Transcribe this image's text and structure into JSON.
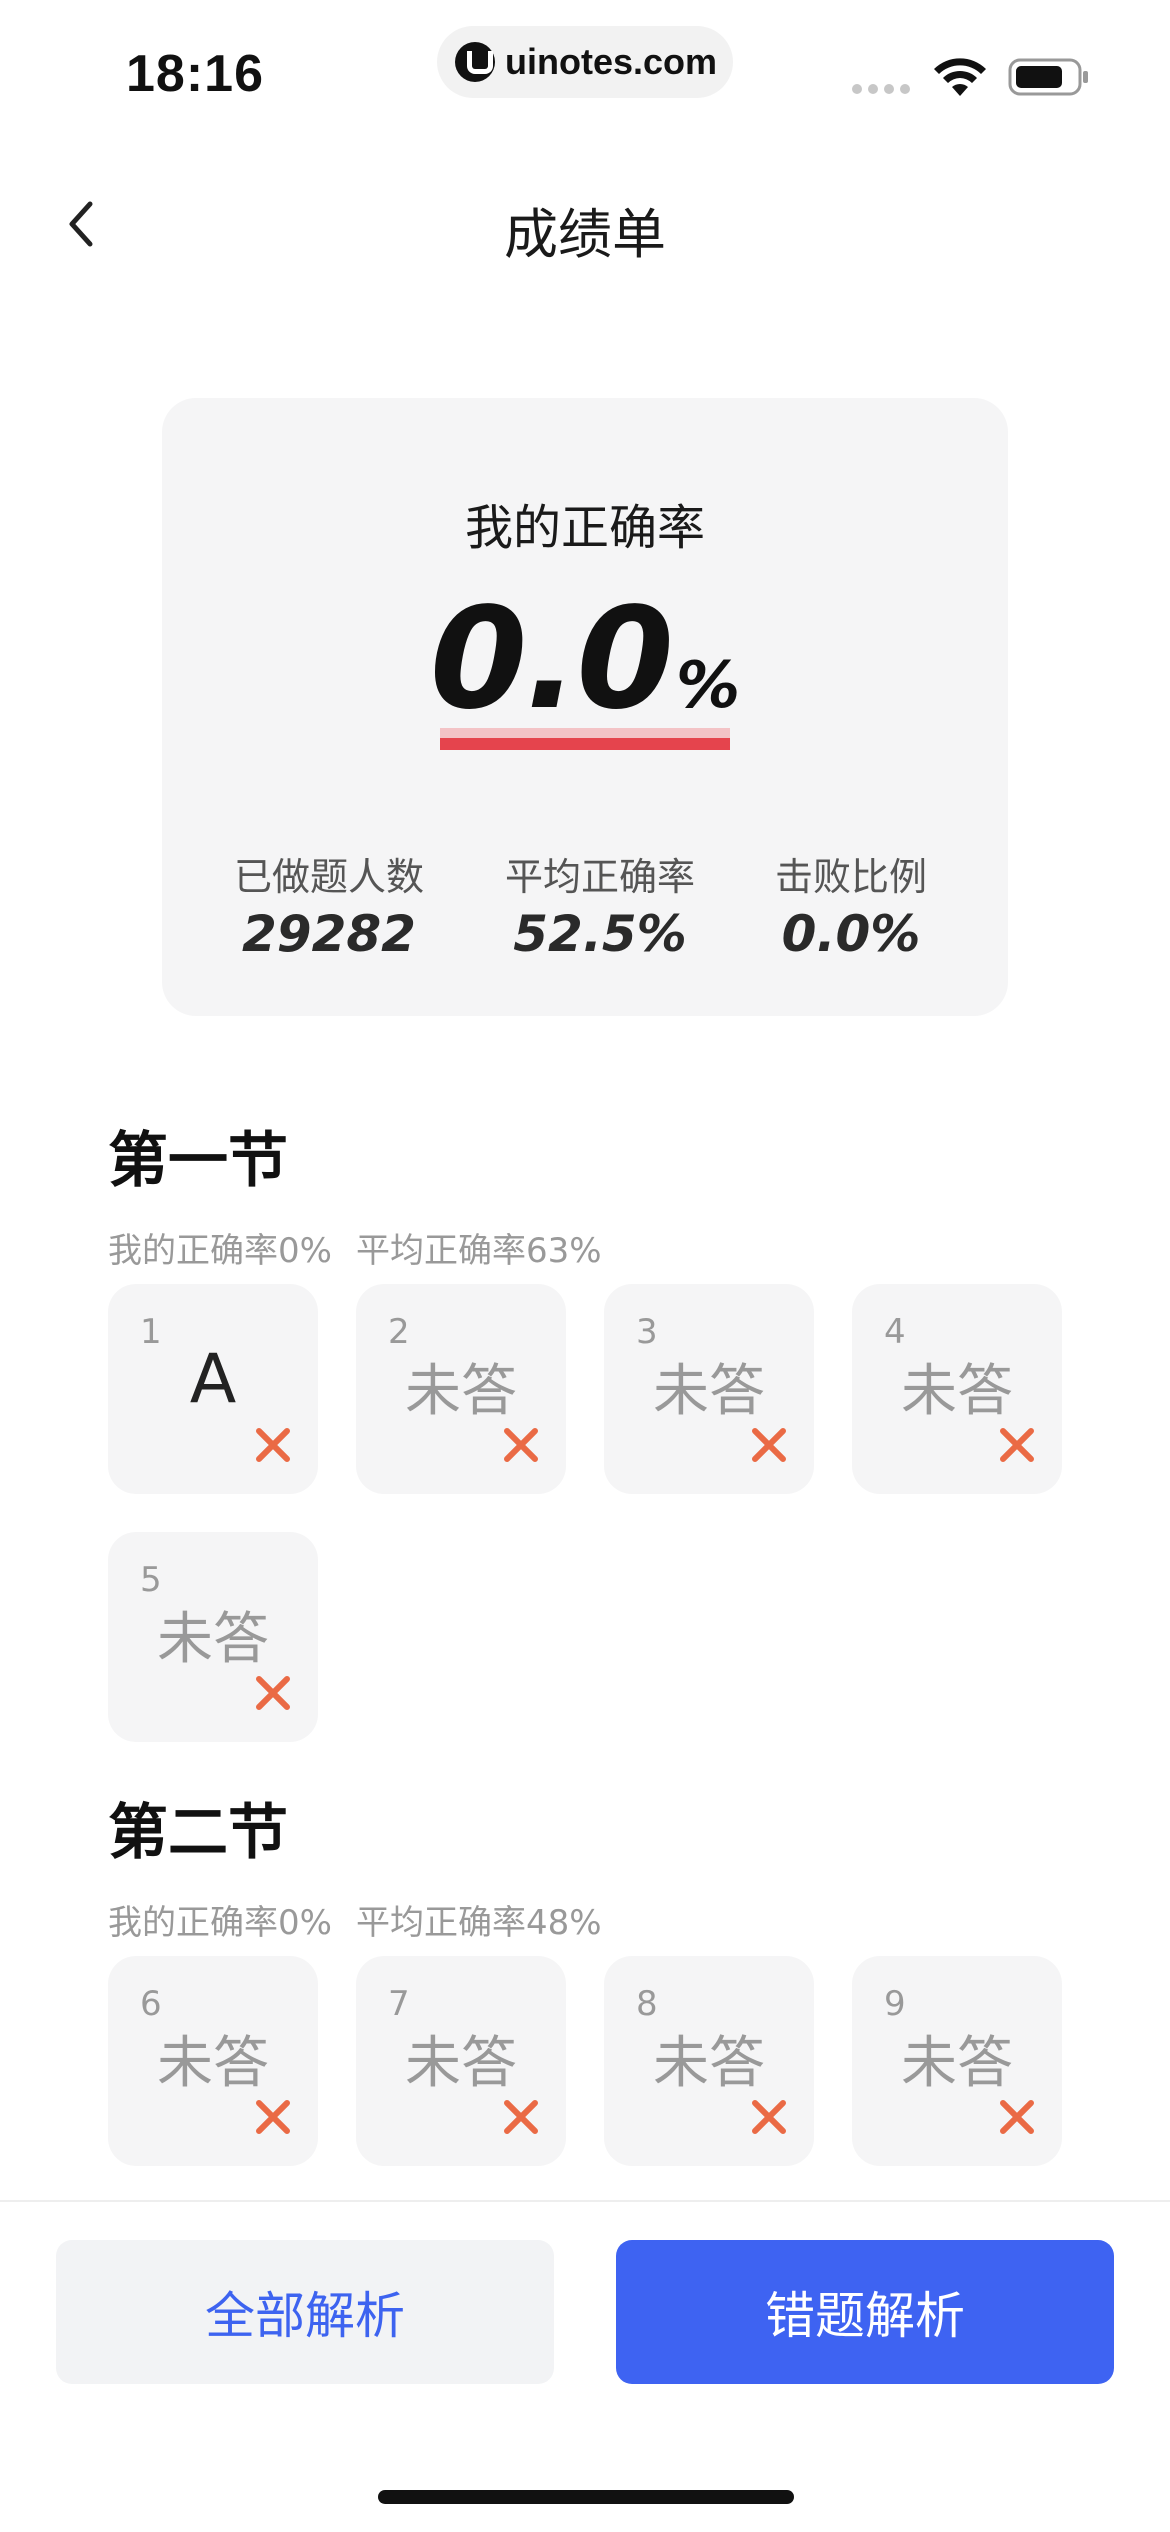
{
  "status_bar": {
    "time": "18:16",
    "url": "uinotes.com"
  },
  "nav": {
    "title": "成绩单"
  },
  "score_card": {
    "label": "我的正确率",
    "value": "0.0",
    "unit": "%",
    "stats": [
      {
        "label": "已做题人数",
        "value": "29282"
      },
      {
        "label": "平均正确率",
        "value": "52.5%"
      },
      {
        "label": "击败比例",
        "value": "0.0%"
      }
    ]
  },
  "sections": [
    {
      "title": "第一节",
      "my_rate": "我的正确率0%",
      "avg_rate": "平均正确率63%",
      "questions": [
        {
          "num": "1",
          "answer": "A",
          "answered": true
        },
        {
          "num": "2",
          "answer": "未答",
          "answered": false
        },
        {
          "num": "3",
          "answer": "未答",
          "answered": false
        },
        {
          "num": "4",
          "answer": "未答",
          "answered": false
        },
        {
          "num": "5",
          "answer": "未答",
          "answered": false
        }
      ]
    },
    {
      "title": "第二节",
      "my_rate": "我的正确率0%",
      "avg_rate": "平均正确率48%",
      "questions": [
        {
          "num": "6",
          "answer": "未答",
          "answered": false
        },
        {
          "num": "7",
          "answer": "未答",
          "answered": false
        },
        {
          "num": "8",
          "answer": "未答",
          "answered": false
        },
        {
          "num": "9",
          "answer": "未答",
          "answered": false
        }
      ]
    }
  ],
  "buttons": {
    "all_analysis": "全部解析",
    "wrong_analysis": "错题解析"
  },
  "colors": {
    "accent_blue": "#3e63f2",
    "wrong_mark": "#ea6a45",
    "underline_red": "#e5444d",
    "card_bg": "#f5f5f6"
  }
}
